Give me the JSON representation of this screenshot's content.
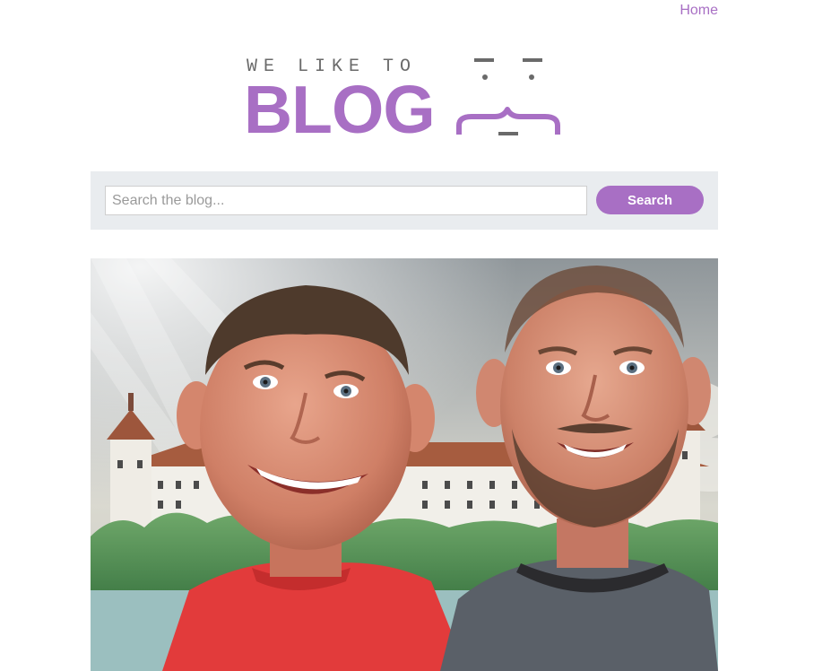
{
  "nav": {
    "home_label": "Home"
  },
  "logo": {
    "tagline": "WE LIKE TO",
    "title": "BLOG"
  },
  "search": {
    "placeholder": "Search the blog...",
    "value": "",
    "button_label": "Search"
  },
  "hero": {
    "image": "two-smiling-men-in-front-of-castle"
  },
  "colors": {
    "accent": "#a86fc4",
    "search_bar_bg": "#e9ecef",
    "logo_gray": "#6a6a6a"
  }
}
